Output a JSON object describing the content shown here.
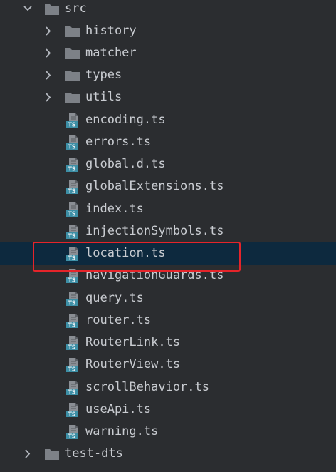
{
  "colors": {
    "background": "#2b2d30",
    "selection": "#0d293e",
    "highlight": "#e5242a",
    "folder": "#7d8187",
    "ts_badge": "#3d8fa6"
  },
  "tree": {
    "root": {
      "label": "src",
      "icon": "folder-icon",
      "state": "expanded"
    },
    "folders": [
      {
        "label": "history",
        "icon": "folder-icon",
        "state": "collapsed"
      },
      {
        "label": "matcher",
        "icon": "folder-icon",
        "state": "collapsed"
      },
      {
        "label": "types",
        "icon": "folder-icon",
        "state": "collapsed"
      },
      {
        "label": "utils",
        "icon": "folder-icon",
        "state": "collapsed"
      }
    ],
    "files": [
      {
        "label": "encoding.ts",
        "icon": "typescript-file-icon"
      },
      {
        "label": "errors.ts",
        "icon": "typescript-file-icon"
      },
      {
        "label": "global.d.ts",
        "icon": "typescript-file-icon"
      },
      {
        "label": "globalExtensions.ts",
        "icon": "typescript-file-icon"
      },
      {
        "label": "index.ts",
        "icon": "typescript-file-icon"
      },
      {
        "label": "injectionSymbols.ts",
        "icon": "typescript-file-icon"
      },
      {
        "label": "location.ts",
        "icon": "typescript-file-icon",
        "selected": true
      },
      {
        "label": "navigationGuards.ts",
        "icon": "typescript-file-icon"
      },
      {
        "label": "query.ts",
        "icon": "typescript-file-icon"
      },
      {
        "label": "router.ts",
        "icon": "typescript-file-icon"
      },
      {
        "label": "RouterLink.ts",
        "icon": "typescript-file-icon"
      },
      {
        "label": "RouterView.ts",
        "icon": "typescript-file-icon"
      },
      {
        "label": "scrollBehavior.ts",
        "icon": "typescript-file-icon"
      },
      {
        "label": "useApi.ts",
        "icon": "typescript-file-icon"
      },
      {
        "label": "warning.ts",
        "icon": "typescript-file-icon"
      }
    ],
    "sibling": {
      "label": "test-dts",
      "icon": "folder-icon",
      "state": "collapsed"
    },
    "ts_badge_text": "TS"
  }
}
